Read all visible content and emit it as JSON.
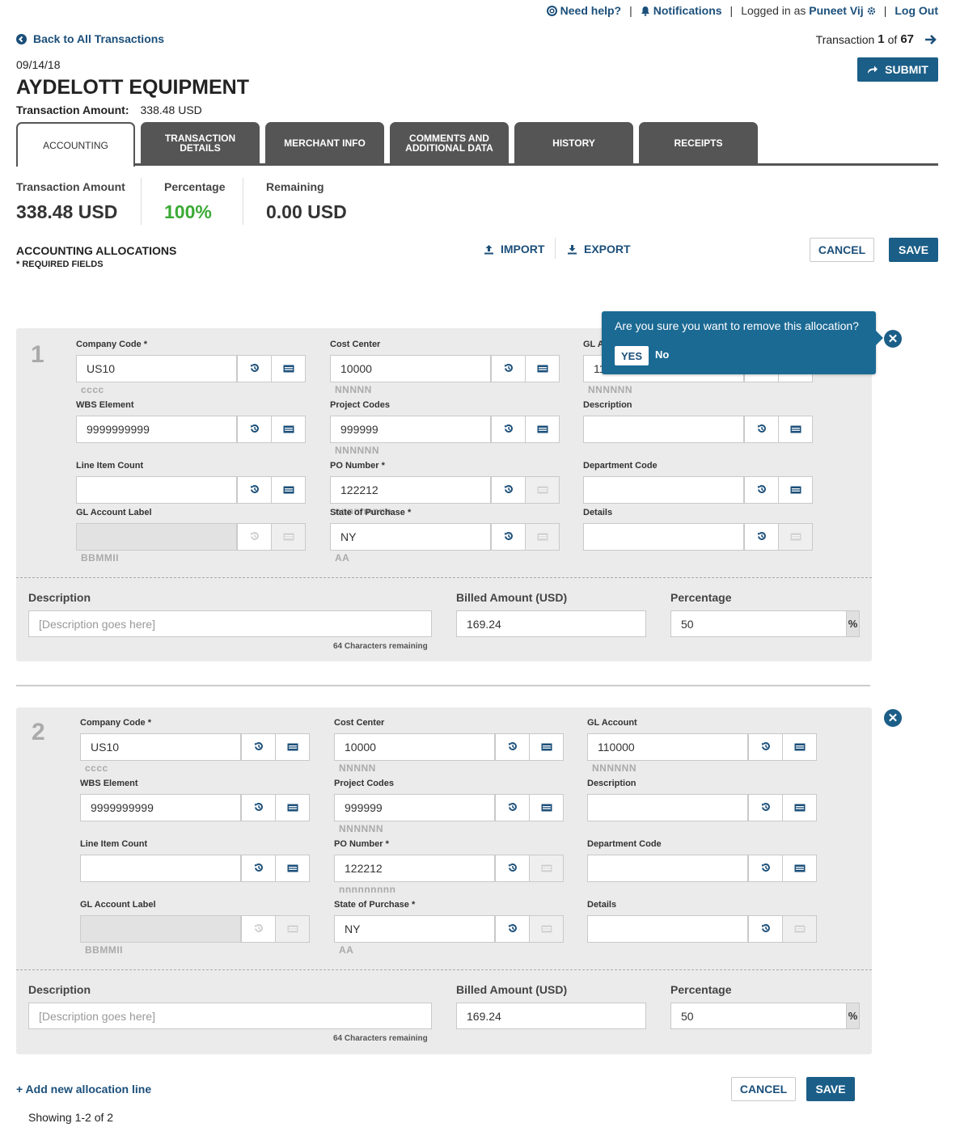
{
  "topbar": {
    "help": "Need help?",
    "notifications": "Notifications",
    "logged_in_as": "Logged in as",
    "user": "Puneet Vij",
    "logout": "Log Out"
  },
  "nav": {
    "back": "Back to All Transactions",
    "transaction_prefix": "Transaction",
    "current": "1",
    "of": "of",
    "total": "67"
  },
  "header": {
    "date": "09/14/18",
    "merchant": "AYDELOTT EQUIPMENT",
    "amount_label": "Transaction Amount:",
    "amount_value": "338.48 USD",
    "submit": "SUBMIT"
  },
  "tabs": [
    "ACCOUNTING",
    "TRANSACTION DETAILS",
    "MERCHANT INFO",
    "COMMENTS AND ADDITIONAL DATA",
    "HISTORY",
    "RECEIPTS"
  ],
  "summary": {
    "amount_label": "Transaction Amount",
    "amount_value": "338.48 USD",
    "pct_label": "Percentage",
    "pct_value": "100%",
    "remain_label": "Remaining",
    "remain_value": "0.00 USD"
  },
  "section": {
    "title": "ACCOUNTING ALLOCATIONS",
    "required": "* REQUIRED FIELDS",
    "import": "IMPORT",
    "export": "EXPORT",
    "cancel": "CANCEL",
    "save": "SAVE"
  },
  "popover": {
    "question": "Are you sure you want to remove this allocation?",
    "yes": "YES",
    "no": "No"
  },
  "allocations": [
    {
      "number": "1",
      "fields": {
        "company_code": {
          "label": "Company Code *",
          "value": "US10",
          "hint": "cccc"
        },
        "cost_center": {
          "label": "Cost Center",
          "value": "10000",
          "hint": "NNNNN"
        },
        "gl_account": {
          "label": "GL A",
          "value": "11",
          "hint": "NNNNNN"
        },
        "wbs": {
          "label": "WBS Element",
          "value": "9999999999"
        },
        "project_codes": {
          "label": "Project Codes",
          "value": "999999",
          "hint": "NNNNNN"
        },
        "description": {
          "label": "Description",
          "value": ""
        },
        "line_item": {
          "label": "Line Item Count",
          "value": ""
        },
        "po_number": {
          "label": "PO Number *",
          "value": "122212",
          "hint": "nnnnnnnnn"
        },
        "dept_code": {
          "label": "Department Code",
          "value": ""
        },
        "gl_label": {
          "label": "GL Account Label",
          "value": "",
          "hint": "BBMMII"
        },
        "state": {
          "label": "State of Purchase *",
          "value": "NY",
          "hint": "AA"
        },
        "details": {
          "label": "Details",
          "value": ""
        }
      },
      "bottom": {
        "desc_label": "Description",
        "desc_placeholder": "[Description goes here]",
        "remaining": "64 Characters remaining",
        "billed_label": "Billed Amount (USD)",
        "billed_value": "169.24",
        "pct_label": "Percentage",
        "pct_value": "50",
        "pct_symbol": "%"
      }
    },
    {
      "number": "2",
      "fields": {
        "company_code": {
          "label": "Company Code *",
          "value": "US10",
          "hint": "cccc"
        },
        "cost_center": {
          "label": "Cost Center",
          "value": "10000",
          "hint": "NNNNN"
        },
        "gl_account": {
          "label": "GL Account",
          "value": "110000",
          "hint": "NNNNNN"
        },
        "wbs": {
          "label": "WBS Element",
          "value": "9999999999"
        },
        "project_codes": {
          "label": "Project Codes",
          "value": "999999",
          "hint": "NNNNNN"
        },
        "description": {
          "label": "Description",
          "value": ""
        },
        "line_item": {
          "label": "Line Item Count",
          "value": ""
        },
        "po_number": {
          "label": "PO Number *",
          "value": "122212",
          "hint": "nnnnnnnnn"
        },
        "dept_code": {
          "label": "Department Code",
          "value": ""
        },
        "gl_label": {
          "label": "GL Account Label",
          "value": "",
          "hint": "BBMMII"
        },
        "state": {
          "label": "State of Purchase *",
          "value": "NY",
          "hint": "AA"
        },
        "details": {
          "label": "Details",
          "value": ""
        }
      },
      "bottom": {
        "desc_label": "Description",
        "desc_placeholder": "[Description goes here]",
        "remaining": "64 Characters remaining",
        "billed_label": "Billed Amount (USD)",
        "billed_value": "169.24",
        "pct_label": "Percentage",
        "pct_value": "50",
        "pct_symbol": "%"
      }
    }
  ],
  "footer": {
    "add_line": "+ Add new allocation line",
    "cancel": "CANCEL",
    "save": "SAVE",
    "showing": "Showing 1-2 of 2"
  },
  "colors": {
    "brand": "#1b5e87",
    "link": "#1b4f7a",
    "success": "#3aaa35",
    "tab_dark": "#555555",
    "panel": "#ebebeb"
  },
  "icons": [
    "help-icon",
    "bell-icon",
    "gear-icon",
    "back-arrow-icon",
    "next-arrow-icon",
    "share-icon",
    "upload-icon",
    "download-icon",
    "history-icon",
    "list-icon",
    "close-icon"
  ]
}
